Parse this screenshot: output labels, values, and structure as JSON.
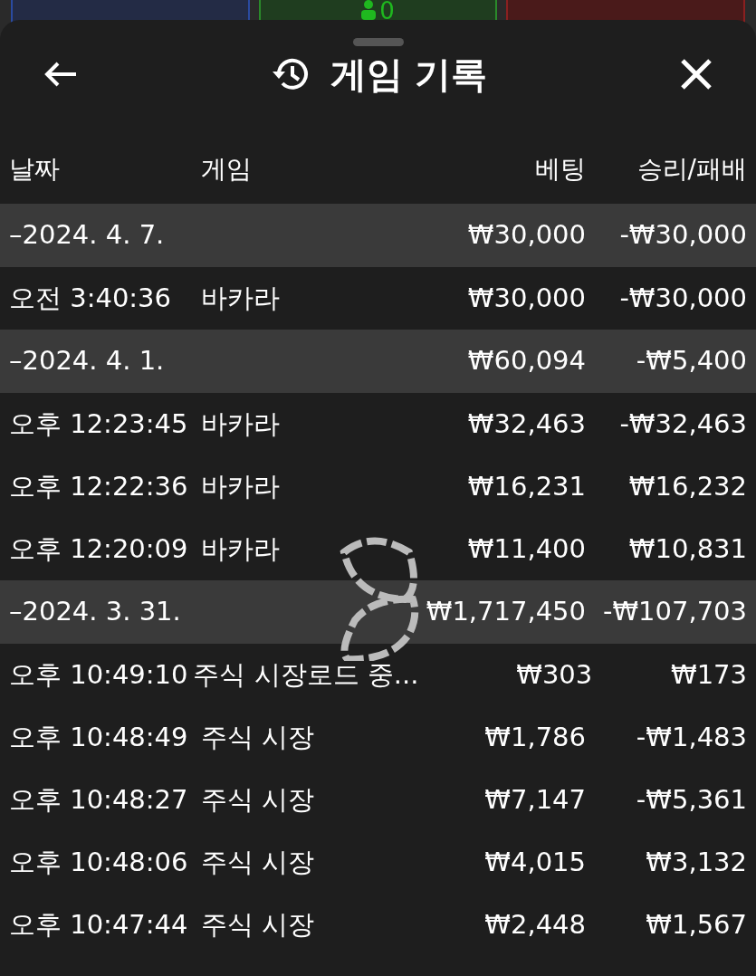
{
  "top_bar": {
    "center_count": "0"
  },
  "sheet": {
    "title": "게임 기록"
  },
  "table": {
    "columns": [
      "날짜",
      "게임",
      "베팅",
      "승리/패배"
    ],
    "rows": [
      {
        "kind": "date",
        "date": "–2024. 4. 7.",
        "bet": "₩30,000",
        "result": "-₩30,000"
      },
      {
        "kind": "game",
        "date": "오전 3:40:36",
        "game": "바카라",
        "bet": "₩30,000",
        "result": "-₩30,000"
      },
      {
        "kind": "date",
        "date": "–2024. 4. 1.",
        "bet": "₩60,094",
        "result": "-₩5,400"
      },
      {
        "kind": "game",
        "date": "오후 12:23:45",
        "game": "바카라",
        "bet": "₩32,463",
        "result": "-₩32,463"
      },
      {
        "kind": "game",
        "date": "오후 12:22:36",
        "game": "바카라",
        "bet": "₩16,231",
        "result": "₩16,232"
      },
      {
        "kind": "game",
        "date": "오후 12:20:09",
        "game": "바카라",
        "bet": "₩11,400",
        "result": "₩10,831"
      },
      {
        "kind": "date",
        "date": "–2024. 3. 31.",
        "bet": "₩1,717,450",
        "result": "-₩107,703"
      },
      {
        "kind": "game",
        "date": "오후 10:49:10",
        "game": "주식 시장로드 중...",
        "bet": "₩303",
        "result": "₩173"
      },
      {
        "kind": "game",
        "date": "오후 10:48:49",
        "game": "주식 시장",
        "bet": "₩1,786",
        "result": "-₩1,483"
      },
      {
        "kind": "game",
        "date": "오후 10:48:27",
        "game": "주식 시장",
        "bet": "₩7,147",
        "result": "-₩5,361"
      },
      {
        "kind": "game",
        "date": "오후 10:48:06",
        "game": "주식 시장",
        "bet": "₩4,015",
        "result": "₩3,132"
      },
      {
        "kind": "game",
        "date": "오후 10:47:44",
        "game": "주식 시장",
        "bet": "₩2,448",
        "result": "₩1,567"
      }
    ]
  }
}
